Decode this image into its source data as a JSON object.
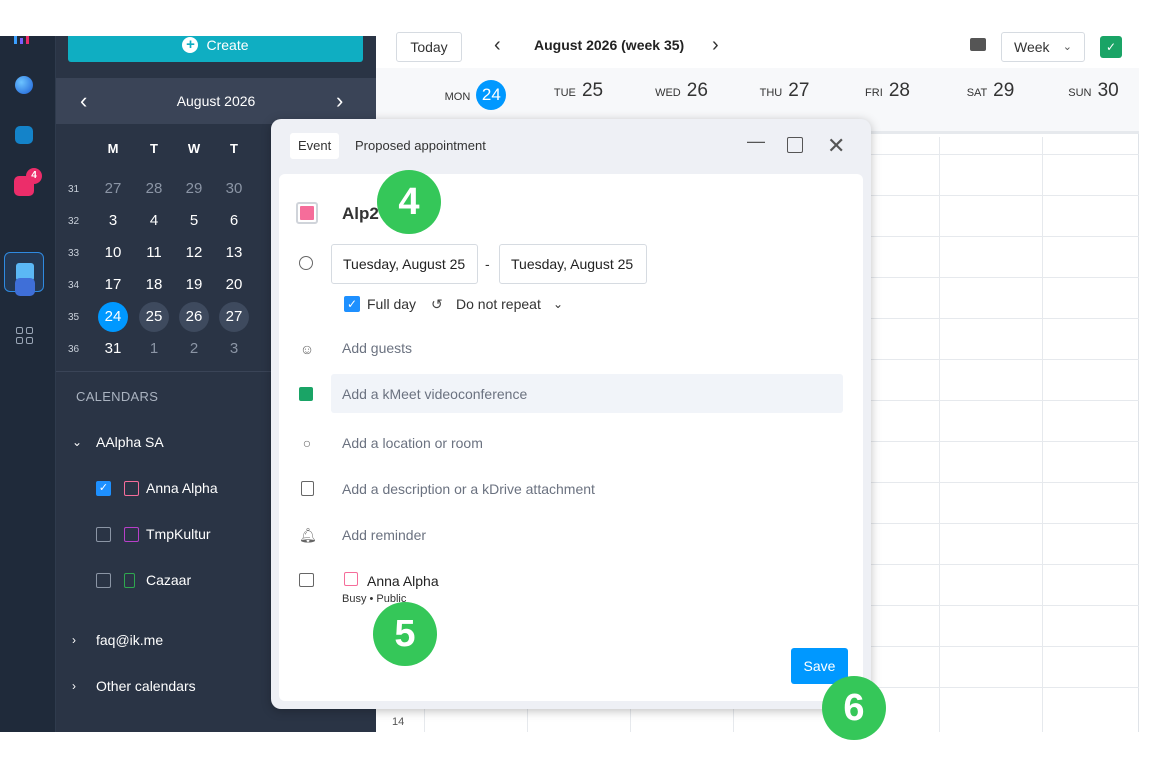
{
  "sidebar": {
    "create_label": "Create",
    "month_title": "August  2026",
    "weekdays": [
      "M",
      "T",
      "W",
      "T"
    ],
    "weeks": [
      {
        "num": "31",
        "days": [
          "27",
          "28",
          "29",
          "30"
        ]
      },
      {
        "num": "32",
        "days": [
          "3",
          "4",
          "5",
          "6"
        ]
      },
      {
        "num": "33",
        "days": [
          "10",
          "11",
          "12",
          "13"
        ]
      },
      {
        "num": "34",
        "days": [
          "17",
          "18",
          "19",
          "20"
        ]
      },
      {
        "num": "35",
        "days": [
          "24",
          "25",
          "26",
          "27"
        ]
      },
      {
        "num": "36",
        "days": [
          "31",
          "1",
          "2",
          "3"
        ]
      }
    ],
    "calendars_heading": "CALENDARS",
    "group_name": "AAlpha SA",
    "calendars": [
      {
        "name": "Anna Alpha",
        "checked": true,
        "color": "#f56d9a"
      },
      {
        "name": "TmpKultur",
        "checked": false,
        "color": "#b83fc9"
      },
      {
        "name": "Cazaar",
        "checked": false,
        "color": "#2fa84f"
      }
    ],
    "other_groups": [
      "faq@ik.me",
      "Other calendars"
    ],
    "rail_badge": "4"
  },
  "toolbar": {
    "today_label": "Today",
    "week_title": "August 2026 (week 35)",
    "view_label": "Week"
  },
  "week_days": [
    {
      "dow": "MON",
      "num": "24",
      "today": true
    },
    {
      "dow": "TUE",
      "num": "25"
    },
    {
      "dow": "WED",
      "num": "26"
    },
    {
      "dow": "THU",
      "num": "27"
    },
    {
      "dow": "FRI",
      "num": "28"
    },
    {
      "dow": "SAT",
      "num": "29"
    },
    {
      "dow": "SUN",
      "num": "30"
    }
  ],
  "hour_label": "14",
  "modal": {
    "tabs": [
      "Event",
      "Proposed appointment"
    ],
    "title_value": "Alp2",
    "start_date": "Tuesday, August 25",
    "end_date": "Tuesday, August 25",
    "date_separator": "-",
    "full_day_label": "Full day",
    "repeat_label": "Do not repeat",
    "guests_placeholder": "Add guests",
    "kmeet_label": "Add a kMeet videoconference",
    "location_placeholder": "Add a location or room",
    "description_placeholder": "Add a description or a kDrive attachment",
    "reminder_label": "Add reminder",
    "calendar_name": "Anna Alpha",
    "calendar_status": "Busy • Public",
    "save_label": "Save"
  },
  "steps": [
    "4",
    "5",
    "6"
  ],
  "colors": {
    "accent": "#0098ff",
    "create": "#0faec2",
    "step_marker": "#35c759",
    "sidebar_bg": "#2a3445"
  }
}
